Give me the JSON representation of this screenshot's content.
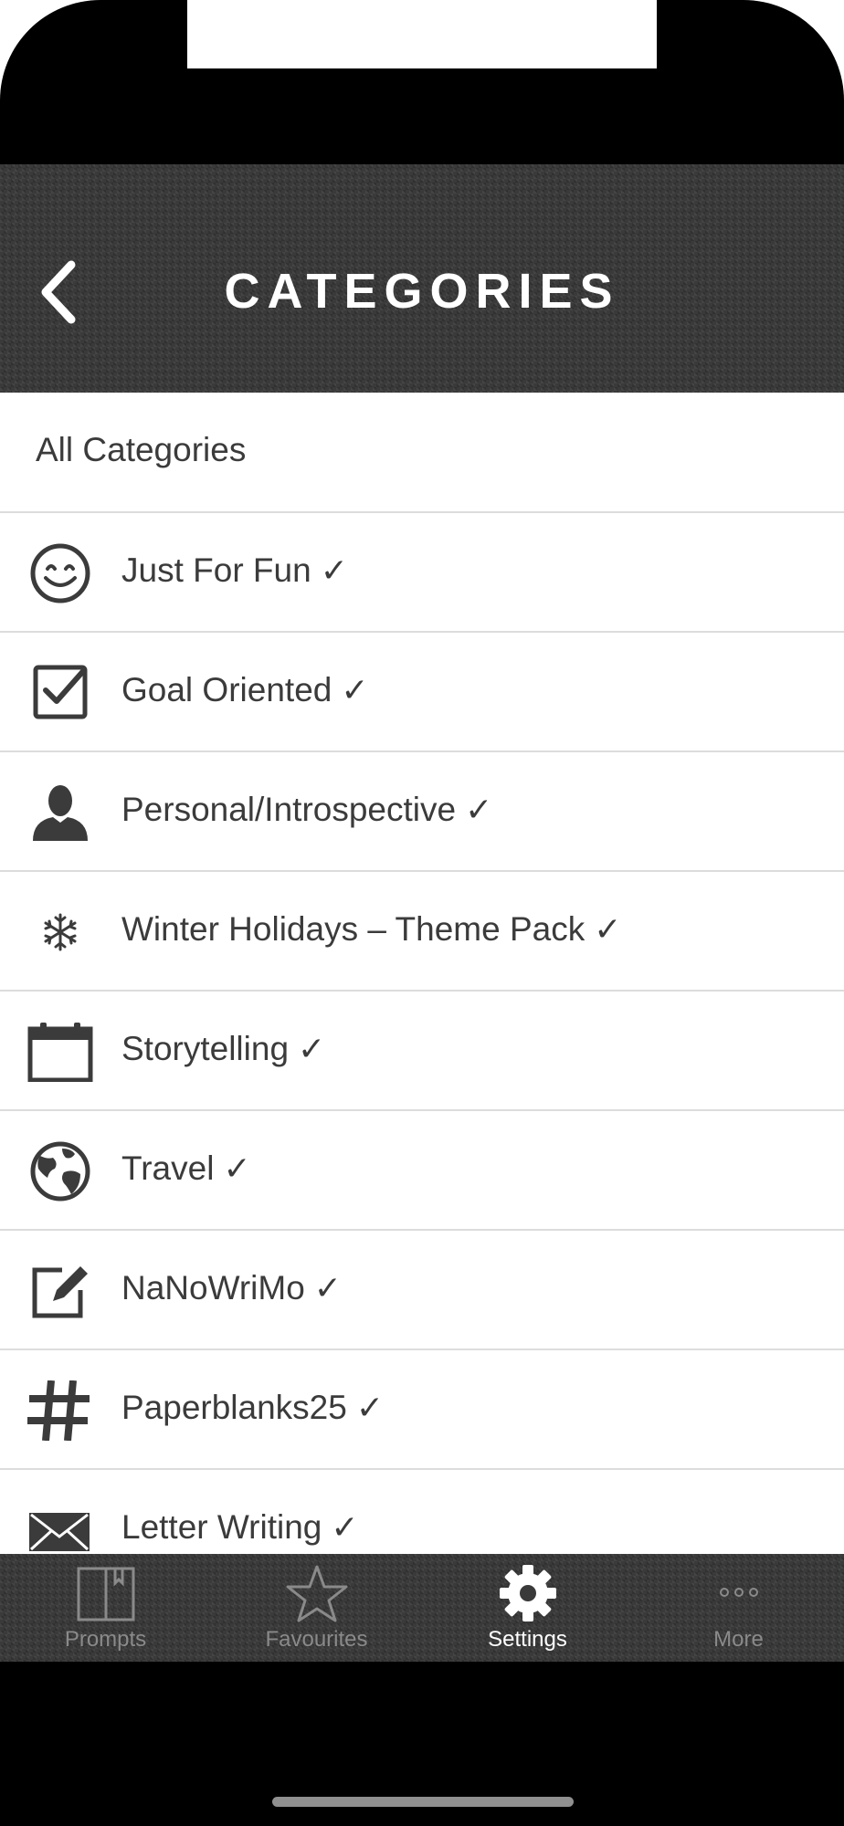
{
  "nav": {
    "title": "CATEGORIES",
    "back_icon": "chevron-left-icon"
  },
  "list": {
    "all_label": "All Categories",
    "check": "✓",
    "items": [
      {
        "label": "Just For Fun",
        "icon": "smiley-icon",
        "checked": true
      },
      {
        "label": "Goal Oriented",
        "icon": "checkbox-icon",
        "checked": true
      },
      {
        "label": "Personal/Introspective",
        "icon": "person-icon",
        "checked": true
      },
      {
        "label": "Winter Holidays – Theme Pack",
        "icon": "snowflake-icon",
        "checked": true
      },
      {
        "label": "Storytelling",
        "icon": "calendar-icon",
        "checked": true
      },
      {
        "label": "Travel",
        "icon": "globe-icon",
        "checked": true
      },
      {
        "label": "NaNoWriMo",
        "icon": "edit-icon",
        "checked": true
      },
      {
        "label": "Paperblanks25",
        "icon": "hashtag-icon",
        "checked": true
      },
      {
        "label": "Letter Writing",
        "icon": "envelope-icon",
        "checked": true
      }
    ]
  },
  "tabbar": {
    "tabs": [
      {
        "label": "Prompts",
        "icon": "book-icon",
        "active": false
      },
      {
        "label": "Favourites",
        "icon": "star-icon",
        "active": false
      },
      {
        "label": "Settings",
        "icon": "gear-icon",
        "active": true
      },
      {
        "label": "More",
        "icon": "more-dots-icon",
        "active": false
      }
    ]
  }
}
